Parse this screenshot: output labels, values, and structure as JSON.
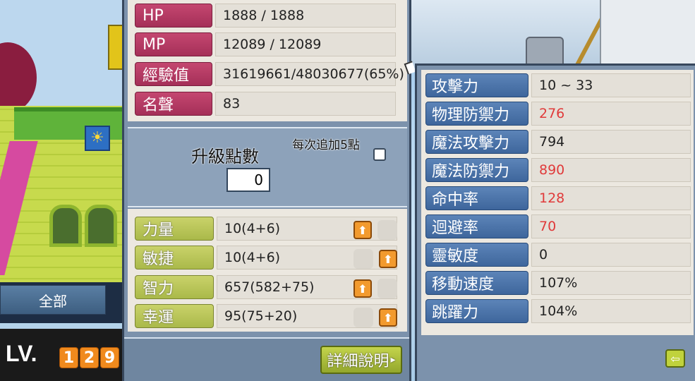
{
  "background": {
    "tab_all_label": "全部",
    "level_label": "LV.",
    "level_digits": [
      "1",
      "2",
      "9"
    ]
  },
  "basic_stats": [
    {
      "label": "HP",
      "value": "1888 / 1888"
    },
    {
      "label": "MP",
      "value": "12089 / 12089"
    },
    {
      "label": "經驗值",
      "value": "31619661/48030677(65%)"
    },
    {
      "label": "名聲",
      "value": "83"
    }
  ],
  "ability_points": {
    "label": "升級點數",
    "value": "0",
    "per_add_label": "每次追加5點"
  },
  "main_stats": [
    {
      "label": "力量",
      "value": "10(4+6)",
      "plus_side": "left"
    },
    {
      "label": "敏捷",
      "value": "10(4+6)",
      "plus_side": "right"
    },
    {
      "label": "智力",
      "value": "657(582+75)",
      "plus_side": "left"
    },
    {
      "label": "幸運",
      "value": "95(75+20)",
      "plus_side": "right"
    }
  ],
  "detail_button_label": "詳細說明",
  "detail_stats": [
    {
      "label": "攻擊力",
      "value": "10 ~ 33",
      "color": "#222222"
    },
    {
      "label": "物理防禦力",
      "value": "276",
      "color": "#e03a3a"
    },
    {
      "label": "魔法攻擊力",
      "value": "794",
      "color": "#222222"
    },
    {
      "label": "魔法防禦力",
      "value": "890",
      "color": "#e03a3a"
    },
    {
      "label": "命中率",
      "value": "128",
      "color": "#e03a3a"
    },
    {
      "label": "迴避率",
      "value": "70",
      "color": "#e03a3a"
    },
    {
      "label": "靈敏度",
      "value": "0",
      "color": "#222222"
    },
    {
      "label": "移動速度",
      "value": "107%",
      "color": "#222222"
    },
    {
      "label": "跳躍力",
      "value": "104%",
      "color": "#222222"
    }
  ]
}
